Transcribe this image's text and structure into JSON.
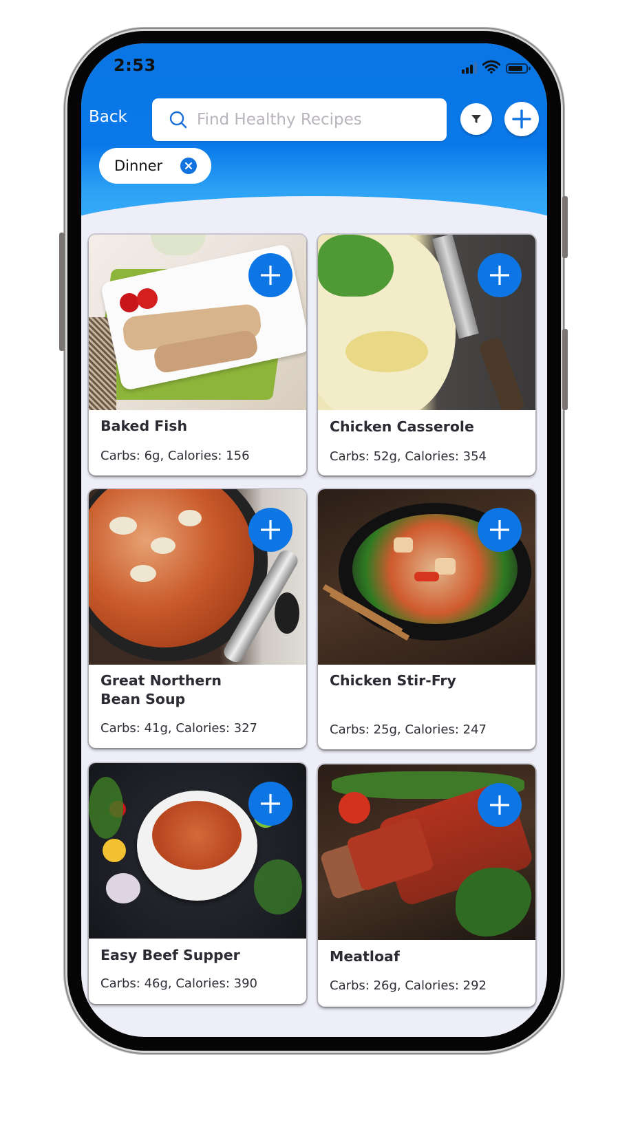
{
  "status_bar": {
    "time": "2:53"
  },
  "header": {
    "back_label": "Back",
    "search": {
      "placeholder": "Find Healthy Recipes",
      "value": ""
    },
    "filter_icon": "filter-funnel-icon",
    "add_icon": "plus-icon"
  },
  "active_filters": [
    {
      "label": "Dinner",
      "remove_icon": "close-circle-icon"
    }
  ],
  "colors": {
    "brand_blue": "#0A76E6",
    "header_light_blue": "#3AAEFB",
    "background": "#EEEEF8",
    "card_text": "#2B2B33"
  },
  "recipes": [
    {
      "name": "Baked Fish",
      "carbs": "6g",
      "calories": "156",
      "meta": "Carbs: 6g, Calories: 156"
    },
    {
      "name": "Chicken Casserole",
      "carbs": "52g",
      "calories": "354",
      "meta": "Carbs: 52g, Calories: 354"
    },
    {
      "name": "Great Northern Bean Soup",
      "carbs": "41g",
      "calories": "327",
      "meta": "Carbs: 41g, Calories: 327"
    },
    {
      "name": "Chicken Stir-Fry",
      "carbs": "25g",
      "calories": "247",
      "meta": "Carbs: 25g, Calories: 247"
    },
    {
      "name": "Easy Beef Supper",
      "carbs": "46g",
      "calories": "390",
      "meta": "Carbs: 46g, Calories: 390"
    },
    {
      "name": "Meatloaf",
      "carbs": "26g",
      "calories": "292",
      "meta": "Carbs: 26g, Calories: 292"
    }
  ]
}
